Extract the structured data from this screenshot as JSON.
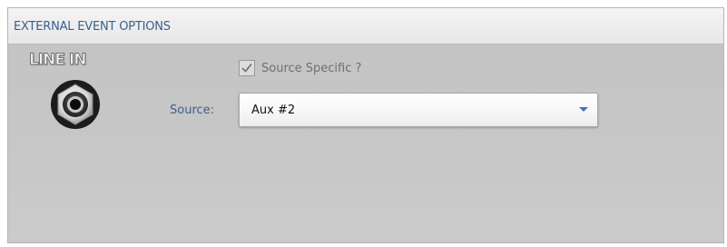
{
  "panel": {
    "title": "EXTERNAL EVENT OPTIONS"
  },
  "line_in": {
    "label": "LINE IN",
    "icon": "audio-jack-icon"
  },
  "source_specific": {
    "label": "Source Specific ?",
    "checked": true
  },
  "source": {
    "label": "Source:",
    "selected": "Aux #2"
  },
  "colors": {
    "title_text": "#3b5f8f",
    "panel_bg": "#c6c6c6",
    "dropdown_arrow": "#3f72b8"
  }
}
